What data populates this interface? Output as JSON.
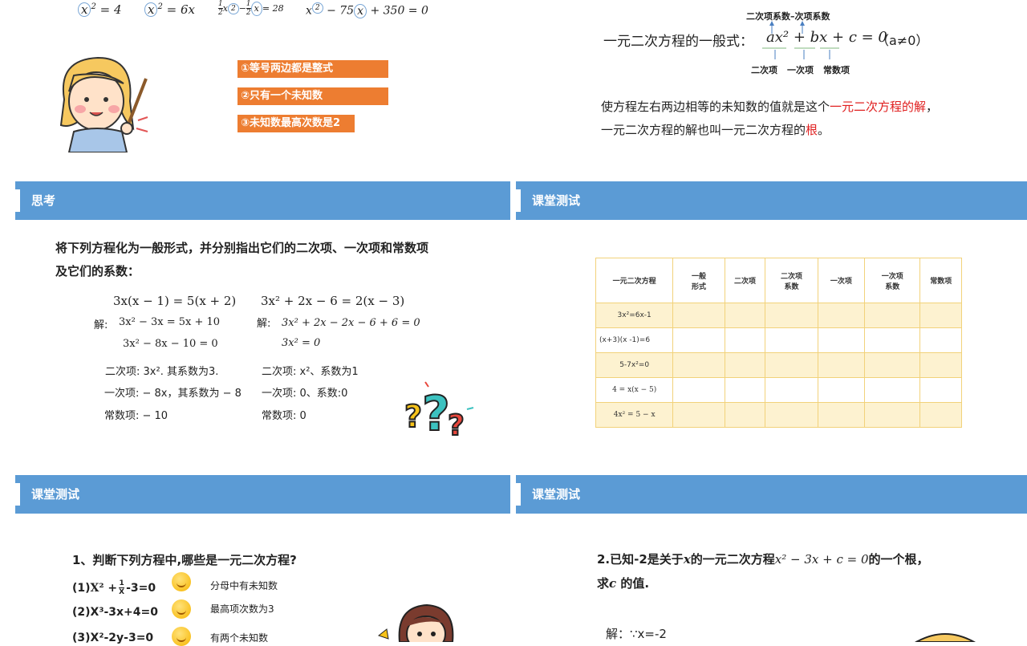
{
  "top_left": {
    "eq1_a": "x",
    "eq1_b": "2",
    "eq1_c": " = 4",
    "eq2_a": "x",
    "eq2_b": "2",
    "eq2_c": " = 6x",
    "eq3_f1n": "1",
    "eq3_f1d": "2",
    "eq3_b": "x",
    "eq3_c": "2",
    "eq3_d": " − ",
    "eq3_f2n": "1",
    "eq3_f2d": "2",
    "eq3_e": "x",
    "eq3_f": " = 28",
    "eq4_a": "x",
    "eq4_b": "2",
    "eq4_c": " − 75",
    "eq4_d": "x",
    "eq4_e": " + 350 = 0",
    "tags": [
      "①等号两边都是整式",
      "②只有一个未知数",
      "③未知数最高次数是2"
    ]
  },
  "top_right": {
    "coef_label": "二次项系数–次项系数",
    "general_label": "一元二次方程的一般式：",
    "general_eq": "ax² + bx + c = 0",
    "general_cond": "（a≠0）",
    "term_quad": "二次项",
    "term_lin": "一次项",
    "term_const": "常数项",
    "line1_a": "使方程左右两边相等的未知数的值就是这个",
    "line1_red": "一元二次方程的解",
    "line1_b": "，",
    "line2_a": "一元二次方程的解也叫一元二次方程的",
    "line2_red": "根",
    "line2_b": "。"
  },
  "mid_left": {
    "banner": "思考",
    "prompt1": "将下列方程化为一般形式，并分别指出它们的二次项、一次项和常数项",
    "prompt2": "及它们的系数：",
    "eqA": "3x(x − 1) = 5(x + 2)",
    "eqB": "3x² + 2x − 6 = 2(x − 3)",
    "solA_label": "解:",
    "solA1": "3x² − 3x = 5x + 10",
    "solA2": "3x² − 8x − 10 = 0",
    "solB_label": "解:",
    "solB1": "3x² + 2x − 2x − 6 + 6 = 0",
    "solB2": "3x² = 0",
    "quadA": "二次项:  3x². 其系数为3.",
    "linA": "一次项:  − 8x，其系数为 − 8",
    "constA": "常数项: − 10",
    "quadB": "二次项:  x²、系数为1",
    "linB": "一次项:  0、系数:0",
    "constB": "常数项:  0"
  },
  "mid_right": {
    "banner": "课堂测试",
    "headers": [
      "一元二次方程",
      "一般\n形式",
      "二次项",
      "二次项\n系数",
      "一次项",
      "一次项\n系数",
      "常数项"
    ],
    "rows": [
      "3x²=6x-1",
      "(x+3)(x -1)=6",
      "5-7x²=0",
      "4 = x(x − 5)",
      "4x² = 5 − x"
    ]
  },
  "bottom_left": {
    "banner": "课堂测试",
    "question": "1、判断下列方程中,哪些是一元二次方程?",
    "items": [
      {
        "label": "(1)",
        "eq_a": "X² +",
        "frac_n": "1",
        "frac_d": "X",
        "eq_b": "-3=0",
        "note": "分母中有未知数"
      },
      {
        "label": "(2)",
        "eq_a": "X³-3x+4=0",
        "note": "最高项次数为3"
      },
      {
        "label": "(3)",
        "eq_a": "X²-2y-3=0",
        "note": "有两个未知数"
      }
    ]
  },
  "bottom_right": {
    "banner": "课堂测试",
    "q_line1_a": "2.已知-2是关于",
    "q_line1_x": "x",
    "q_line1_b": "的一元二次方程",
    "q_line1_eq": "x² − 3x + c = 0",
    "q_line1_c": "的一个根，",
    "q_line2_a": "求",
    "q_line2_c": "c",
    "q_line2_b": " 的值.",
    "sol": "解：∵x=-2"
  },
  "colors": {
    "banner": "#5b9bd5",
    "tag": "#ed7d31",
    "red": "#e02020",
    "table_border": "#f2d27a",
    "table_fill": "#fdf2d0"
  }
}
